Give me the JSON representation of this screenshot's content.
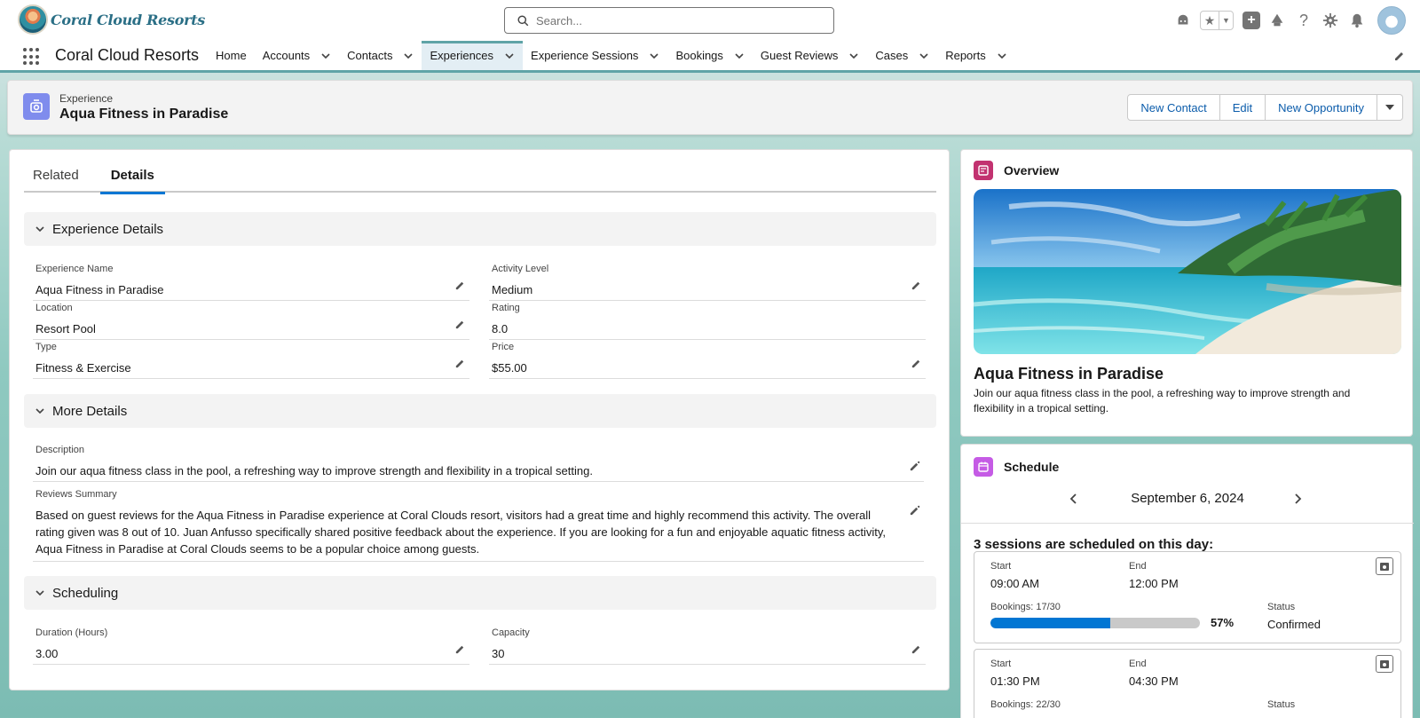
{
  "brand": {
    "logo_text": "Coral Cloud Resorts"
  },
  "search": {
    "placeholder": "Search..."
  },
  "header_icons": [
    "agent-icon",
    "favorites-star-icon",
    "favorites-dropdown-icon",
    "add-icon",
    "trailhead-icon",
    "help-icon",
    "setup-gear-icon",
    "notifications-bell-icon",
    "user-avatar"
  ],
  "nav": {
    "app_name": "Coral Cloud Resorts",
    "items": [
      {
        "label": "Home",
        "has_menu": false
      },
      {
        "label": "Accounts",
        "has_menu": true
      },
      {
        "label": "Contacts",
        "has_menu": true
      },
      {
        "label": "Experiences",
        "has_menu": true,
        "active": true
      },
      {
        "label": "Experience Sessions",
        "has_menu": true
      },
      {
        "label": "Bookings",
        "has_menu": true
      },
      {
        "label": "Guest Reviews",
        "has_menu": true
      },
      {
        "label": "Cases",
        "has_menu": true
      },
      {
        "label": "Reports",
        "has_menu": true
      }
    ]
  },
  "record": {
    "object_type": "Experience",
    "name": "Aqua Fitness in Paradise",
    "actions": [
      "New Contact",
      "Edit",
      "New Opportunity"
    ]
  },
  "tabs": [
    "Related",
    "Details"
  ],
  "active_tab": "Details",
  "sections": {
    "experience_details": {
      "title": "Experience Details",
      "fields": {
        "experience_name": {
          "label": "Experience Name",
          "value": "Aqua Fitness in Paradise"
        },
        "activity_level": {
          "label": "Activity Level",
          "value": "Medium"
        },
        "location": {
          "label": "Location",
          "value": "Resort Pool"
        },
        "rating": {
          "label": "Rating",
          "value": "8.0"
        },
        "type": {
          "label": "Type",
          "value": "Fitness & Exercise"
        },
        "price": {
          "label": "Price",
          "value": "$55.00"
        }
      }
    },
    "more_details": {
      "title": "More Details",
      "fields": {
        "description": {
          "label": "Description",
          "value": "Join our aqua fitness class in the pool, a refreshing way to improve strength and flexibility in a tropical setting."
        },
        "reviews_summary": {
          "label": "Reviews Summary",
          "value": "Based on guest reviews for the Aqua Fitness in Paradise experience at Coral Clouds resort, visitors had a great time and highly recommend this activity. The overall rating given was 8 out of 10. Juan Anfusso specifically shared positive feedback about the experience. If you are looking for a fun and enjoyable aquatic fitness activity, Aqua Fitness in Paradise at Coral Clouds seems to be a popular choice among guests."
        }
      }
    },
    "scheduling": {
      "title": "Scheduling",
      "fields": {
        "duration": {
          "label": "Duration (Hours)",
          "value": "3.00"
        },
        "capacity": {
          "label": "Capacity",
          "value": "30"
        }
      }
    }
  },
  "overview": {
    "title": "Overview",
    "experience_name": "Aqua Fitness in Paradise",
    "description": "Join our aqua fitness class in the pool, a refreshing way to improve strength and flexibility in a tropical setting."
  },
  "schedule": {
    "title": "Schedule",
    "date": "September 6, 2024",
    "sessions_text": "3 sessions are scheduled on this day:",
    "labels": {
      "start": "Start",
      "end": "End",
      "status": "Status"
    },
    "sessions": [
      {
        "start": "09:00 AM",
        "end": "12:00 PM",
        "bookings": "Bookings: 17/30",
        "progress": 0.57,
        "percent": "57%",
        "status": "Confirmed"
      },
      {
        "start": "01:30 PM",
        "end": "04:30 PM",
        "bookings": "Bookings: 22/30"
      }
    ]
  },
  "colors": {
    "accent": "#0176d3",
    "nav_underline": "#5fa4a7",
    "experience_icon": "#7f8ced",
    "overview_icon": "#c23270",
    "schedule_icon": "#c55be5"
  }
}
